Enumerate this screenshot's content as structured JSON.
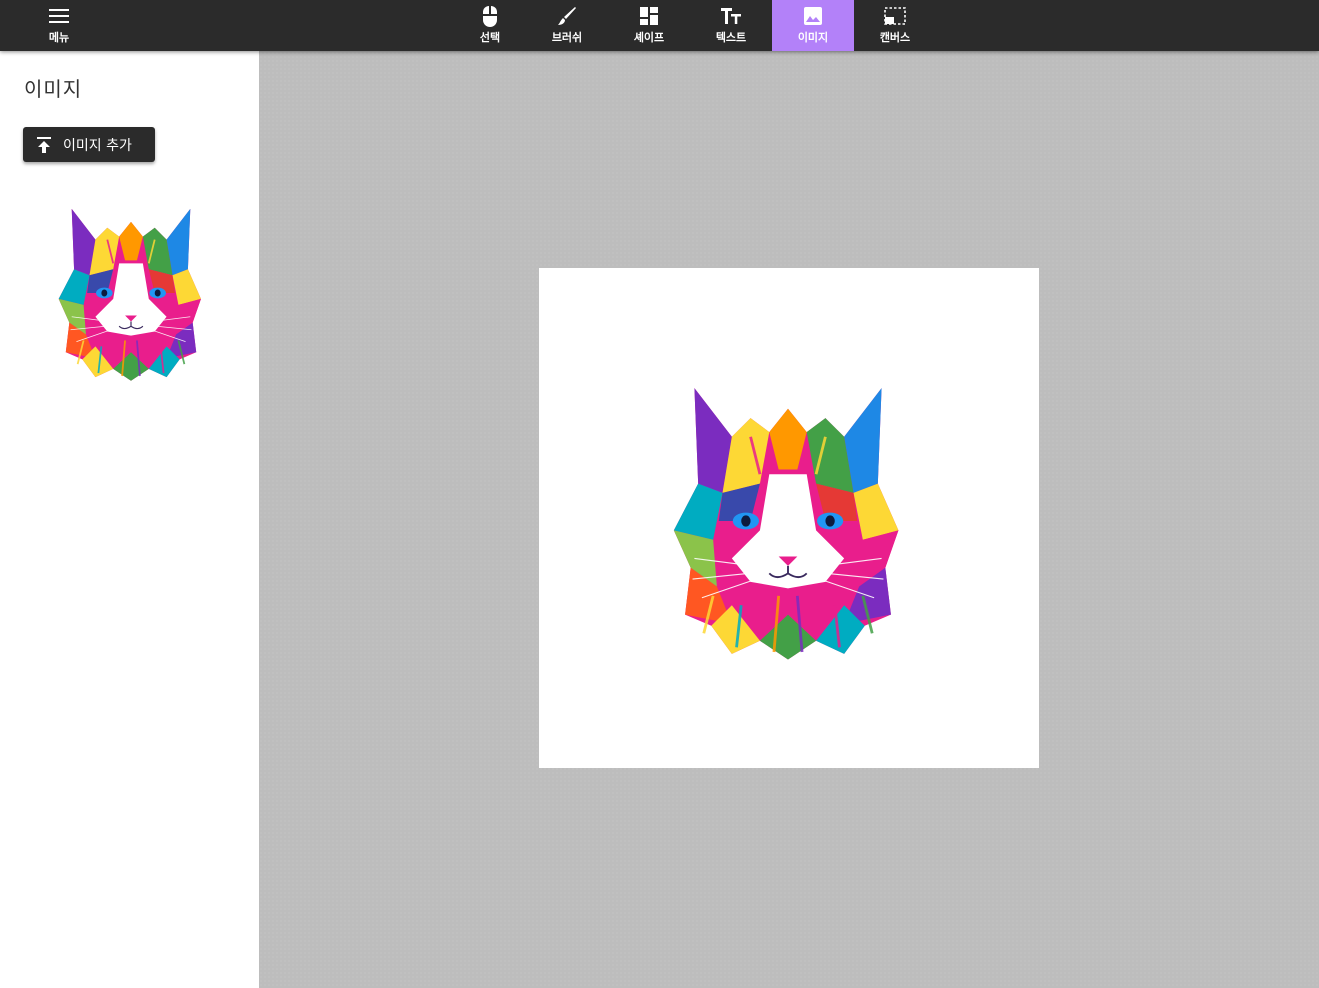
{
  "toolbar": {
    "menu": {
      "label": "메뉴",
      "icon": "hamburger-menu-icon"
    },
    "tools": [
      {
        "id": "select",
        "label": "선택",
        "icon": "mouse-icon"
      },
      {
        "id": "brush",
        "label": "브러쉬",
        "icon": "brush-icon"
      },
      {
        "id": "shape",
        "label": "셰이프",
        "icon": "dashboard-icon"
      },
      {
        "id": "text",
        "label": "텍스트",
        "icon": "text-fields-icon"
      },
      {
        "id": "image",
        "label": "이미지",
        "icon": "image-icon",
        "active": true
      },
      {
        "id": "canvas",
        "label": "캔버스",
        "icon": "canvas-select-icon"
      }
    ],
    "active_color": "#b381f9",
    "background": "#2b2b2b"
  },
  "sidebar": {
    "title": "이미지",
    "add_button": {
      "label": "이미지 추가",
      "icon": "upload-icon"
    },
    "images": [
      {
        "icon": "colorful-cat-thumbnail"
      }
    ]
  },
  "canvas": {
    "background": "#ffffff",
    "objects": [
      {
        "type": "image",
        "icon": "colorful-cat-image"
      }
    ]
  }
}
